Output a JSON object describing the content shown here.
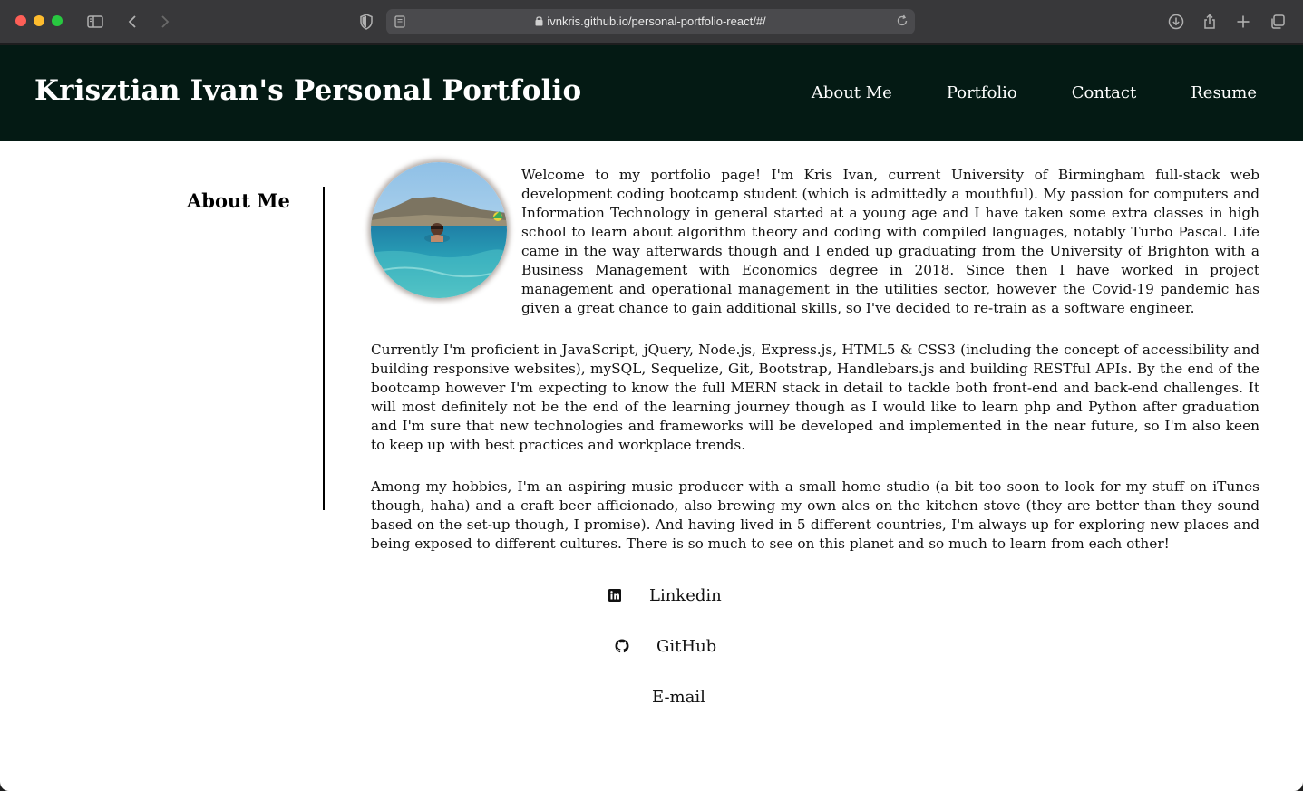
{
  "browser": {
    "url": "ivnkris.github.io/personal-portfolio-react/#/"
  },
  "header": {
    "title": "Krisztian Ivan's Personal Portfolio",
    "nav": [
      "About Me",
      "Portfolio",
      "Contact",
      "Resume"
    ]
  },
  "about": {
    "heading": "About Me",
    "paragraphs": [
      "Welcome to my portfolio page! I'm Kris Ivan, current University of Birmingham full-stack web development coding bootcamp student (which is admittedly a mouthful). My passion for computers and Information Technology in general started at a young age and I have taken some extra classes in high school to learn about algorithm theory and coding with compiled languages, notably Turbo Pascal. Life came in the way afterwards though and I ended up graduating from the University of Brighton with a Business Management with Economics degree in 2018. Since then I have worked in project management and operational management in the utilities sector, however the Covid-19 pandemic has given a great chance to gain additional skills, so I've decided to re-train as a software engineer.",
      "Currently I'm proficient in JavaScript, jQuery, Node.js, Express.js, HTML5 & CSS3 (including the concept of accessibility and building responsive websites), mySQL, Sequelize, Git, Bootstrap, Handlebars.js and building RESTful APIs. By the end of the bootcamp however I'm expecting to know the full MERN stack in detail to tackle both front-end and back-end challenges. It will most definitely not be the end of the learning journey though as I would like to learn php and Python after graduation and I'm sure that new technologies and frameworks will be developed and implemented in the near future, so I'm also keen to keep up with best practices and workplace trends.",
      "Among my hobbies, I'm an aspiring music producer with a small home studio (a bit too soon to look for my stuff on iTunes though, haha) and a craft beer afficionado, also brewing my own ales on the kitchen stove (they are better than they sound based on the set-up though, I promise). And having lived in 5 different countries, I'm always up for exploring new places and being exposed to different cultures. There is so much to see on this planet and so much to learn from each other!"
    ]
  },
  "footer_links": {
    "linkedin": "Linkedin",
    "github": "GitHub",
    "email": "E-mail"
  },
  "colors": {
    "header_bg": "#041a14",
    "page_bg": "#ffffff"
  },
  "icons": [
    "sidebar-icon",
    "back-icon",
    "forward-icon",
    "shield-icon",
    "reader-icon",
    "lock-icon",
    "reload-icon",
    "download-icon",
    "share-icon",
    "plus-icon",
    "tabs-icon",
    "linkedin-icon",
    "github-icon"
  ]
}
